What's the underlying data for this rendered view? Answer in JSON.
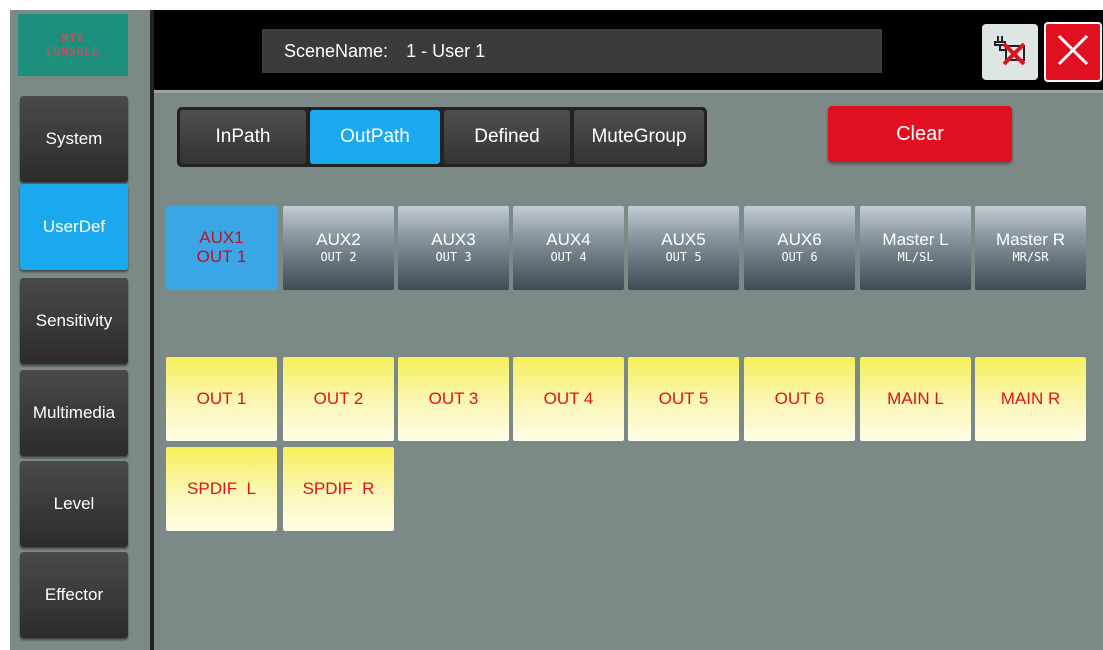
{
  "app": {
    "logo_line1": "MIX",
    "logo_line2": "CONSOLE"
  },
  "sidebar": {
    "items": [
      {
        "label": "System"
      },
      {
        "label": "UserDef"
      },
      {
        "label": "Sensitivity"
      },
      {
        "label": "Multimedia"
      },
      {
        "label": "Level"
      },
      {
        "label": "Effector"
      }
    ],
    "active": "UserDef"
  },
  "header": {
    "scene_label": "SceneName:",
    "scene_value": "1 - User 1"
  },
  "tabs": {
    "items": [
      {
        "label": "InPath"
      },
      {
        "label": "OutPath"
      },
      {
        "label": "Defined"
      },
      {
        "label": "MuteGroup"
      }
    ],
    "active": "OutPath"
  },
  "clear_label": "Clear",
  "aux_buttons": [
    {
      "line1": "AUX1",
      "line2": "OUT 1"
    },
    {
      "line1": "AUX2",
      "line2": "OUT 2"
    },
    {
      "line1": "AUX3",
      "line2": "OUT 3"
    },
    {
      "line1": "AUX4",
      "line2": "OUT 4"
    },
    {
      "line1": "AUX5",
      "line2": "OUT 5"
    },
    {
      "line1": "AUX6",
      "line2": "OUT 6"
    },
    {
      "line1": "Master L",
      "line2": "ML/SL"
    },
    {
      "line1": "Master R",
      "line2": "MR/SR"
    }
  ],
  "aux_active": "AUX1",
  "out_buttons": [
    {
      "label": "OUT 1"
    },
    {
      "label": "OUT 2"
    },
    {
      "label": "OUT 3"
    },
    {
      "label": "OUT 4"
    },
    {
      "label": "OUT 5"
    },
    {
      "label": "OUT 6"
    },
    {
      "label": "MAIN L"
    },
    {
      "label": "MAIN R"
    },
    {
      "label": "SPDIF  L"
    },
    {
      "label": "SPDIF  R"
    }
  ],
  "colors": {
    "accent": "#1aa8ef",
    "clear": "#e01020",
    "panel": "#7c8a87",
    "out_text": "#e01020"
  },
  "icons": {
    "disconnect": "disconnect-icon",
    "close": "close-icon"
  }
}
